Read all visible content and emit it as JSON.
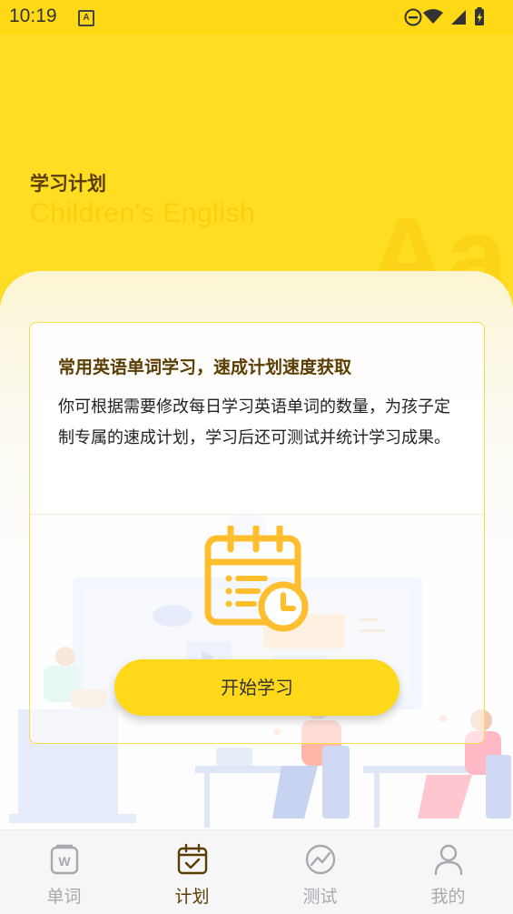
{
  "status_bar": {
    "time": "10:19",
    "icons": [
      "app-notification-icon",
      "do-not-disturb-icon",
      "wifi-icon",
      "signal-icon",
      "battery-icon"
    ]
  },
  "hero": {
    "title": "学习计划",
    "subtitle": "Children's English",
    "decoration_text": "Aa"
  },
  "card": {
    "heading": "常用英语单词学习，速成计划速度获取",
    "description": "你可根据需要修改每日学习英语单词的数量，为孩子定制专属的速成计划，学习后还可测试并统计学习成果。"
  },
  "start_button": {
    "label": "开始学习"
  },
  "tabs": [
    {
      "label": "单词",
      "icon": "word-book-icon",
      "active": false
    },
    {
      "label": "计划",
      "icon": "calendar-check-icon",
      "active": true
    },
    {
      "label": "测试",
      "icon": "chart-test-icon",
      "active": false
    },
    {
      "label": "我的",
      "icon": "person-icon",
      "active": false
    }
  ],
  "colors": {
    "accent": "#ffd81a",
    "hero_bg": "#ffdd22",
    "title_brown": "#5a3d00",
    "tab_inactive": "#a9a9ad",
    "icon_orange": "#ffbe2e"
  }
}
